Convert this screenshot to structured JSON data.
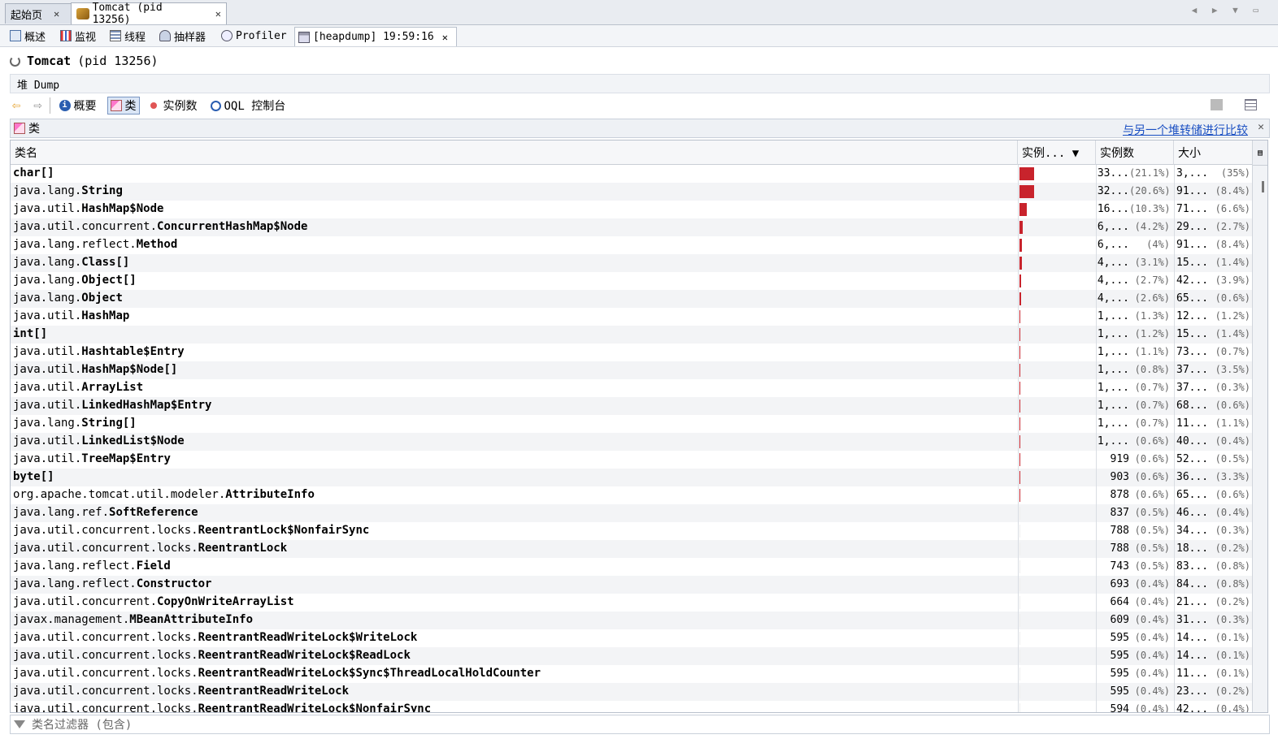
{
  "tabs": [
    {
      "label": "起始页",
      "close": "✕"
    },
    {
      "label": "Tomcat (pid 13256)",
      "close": "✕"
    }
  ],
  "subtabs": [
    {
      "label": "概述",
      "icon": "overview-icon"
    },
    {
      "label": "监视",
      "icon": "monitor-icon"
    },
    {
      "label": "线程",
      "icon": "threads-icon"
    },
    {
      "label": "抽样器",
      "icon": "sampler-icon"
    },
    {
      "label": "Profiler",
      "icon": "profiler-icon"
    },
    {
      "label": "[heapdump] 19:59:16",
      "icon": "heapdump-icon",
      "close": "✕"
    }
  ],
  "app": {
    "name": "Tomcat",
    "pid": "(pid 13256)"
  },
  "heap_label": "堆 Dump",
  "toolbar": {
    "summary": "概要",
    "classes": "类",
    "instances": "实例数",
    "oql": "OQL 控制台"
  },
  "classes_panel": {
    "title": "类",
    "compare_link": "与另一个堆转储进行比较",
    "close": "✕"
  },
  "columns": {
    "name": "类名",
    "instances_bar": "实例... ▼",
    "instances": "实例数",
    "size": "大小"
  },
  "rows": [
    {
      "pkg": "",
      "cls": "char[]",
      "bar": 21.1,
      "count": "33...",
      "count_pct": "(21.1%)",
      "size": "3,...",
      "size_pct": "(35%)"
    },
    {
      "pkg": "java.lang.",
      "cls": "String",
      "bar": 20.6,
      "count": "32...",
      "count_pct": "(20.6%)",
      "size": "91...",
      "size_pct": "(8.4%)"
    },
    {
      "pkg": "java.util.",
      "cls": "HashMap$Node",
      "bar": 10.3,
      "count": "16...",
      "count_pct": "(10.3%)",
      "size": "71...",
      "size_pct": "(6.6%)"
    },
    {
      "pkg": "java.util.concurrent.",
      "cls": "ConcurrentHashMap$Node",
      "bar": 4.2,
      "count": "6,...",
      "count_pct": "(4.2%)",
      "size": "29...",
      "size_pct": "(2.7%)"
    },
    {
      "pkg": "java.lang.reflect.",
      "cls": "Method",
      "bar": 4,
      "count": "6,...",
      "count_pct": "(4%)",
      "size": "91...",
      "size_pct": "(8.4%)"
    },
    {
      "pkg": "java.lang.",
      "cls": "Class[]",
      "bar": 3.1,
      "count": "4,...",
      "count_pct": "(3.1%)",
      "size": "15...",
      "size_pct": "(1.4%)"
    },
    {
      "pkg": "java.lang.",
      "cls": "Object[]",
      "bar": 2.7,
      "count": "4,...",
      "count_pct": "(2.7%)",
      "size": "42...",
      "size_pct": "(3.9%)"
    },
    {
      "pkg": "java.lang.",
      "cls": "Object",
      "bar": 2.6,
      "count": "4,...",
      "count_pct": "(2.6%)",
      "size": "65...",
      "size_pct": "(0.6%)"
    },
    {
      "pkg": "java.util.",
      "cls": "HashMap",
      "bar": 1.3,
      "count": "1,...",
      "count_pct": "(1.3%)",
      "size": "12...",
      "size_pct": "(1.2%)"
    },
    {
      "pkg": "",
      "cls": "int[]",
      "bar": 1.2,
      "count": "1,...",
      "count_pct": "(1.2%)",
      "size": "15...",
      "size_pct": "(1.4%)"
    },
    {
      "pkg": "java.util.",
      "cls": "Hashtable$Entry",
      "bar": 1.1,
      "count": "1,...",
      "count_pct": "(1.1%)",
      "size": "73...",
      "size_pct": "(0.7%)"
    },
    {
      "pkg": "java.util.",
      "cls": "HashMap$Node[]",
      "bar": 0.8,
      "count": "1,...",
      "count_pct": "(0.8%)",
      "size": "37...",
      "size_pct": "(3.5%)"
    },
    {
      "pkg": "java.util.",
      "cls": "ArrayList",
      "bar": 0.7,
      "count": "1,...",
      "count_pct": "(0.7%)",
      "size": "37...",
      "size_pct": "(0.3%)"
    },
    {
      "pkg": "java.util.",
      "cls": "LinkedHashMap$Entry",
      "bar": 0.7,
      "count": "1,...",
      "count_pct": "(0.7%)",
      "size": "68...",
      "size_pct": "(0.6%)"
    },
    {
      "pkg": "java.lang.",
      "cls": "String[]",
      "bar": 0.7,
      "count": "1,...",
      "count_pct": "(0.7%)",
      "size": "11...",
      "size_pct": "(1.1%)"
    },
    {
      "pkg": "java.util.",
      "cls": "LinkedList$Node",
      "bar": 0.6,
      "count": "1,...",
      "count_pct": "(0.6%)",
      "size": "40...",
      "size_pct": "(0.4%)"
    },
    {
      "pkg": "java.util.",
      "cls": "TreeMap$Entry",
      "bar": 0.6,
      "count": "919",
      "count_pct": "(0.6%)",
      "size": "52...",
      "size_pct": "(0.5%)"
    },
    {
      "pkg": "",
      "cls": "byte[]",
      "bar": 0.6,
      "count": "903",
      "count_pct": "(0.6%)",
      "size": "36...",
      "size_pct": "(3.3%)"
    },
    {
      "pkg": "org.apache.tomcat.util.modeler.",
      "cls": "AttributeInfo",
      "bar": 0.6,
      "count": "878",
      "count_pct": "(0.6%)",
      "size": "65...",
      "size_pct": "(0.6%)"
    },
    {
      "pkg": "java.lang.ref.",
      "cls": "SoftReference",
      "bar": 0.5,
      "count": "837",
      "count_pct": "(0.5%)",
      "size": "46...",
      "size_pct": "(0.4%)"
    },
    {
      "pkg": "java.util.concurrent.locks.",
      "cls": "ReentrantLock$NonfairSync",
      "bar": 0.5,
      "count": "788",
      "count_pct": "(0.5%)",
      "size": "34...",
      "size_pct": "(0.3%)"
    },
    {
      "pkg": "java.util.concurrent.locks.",
      "cls": "ReentrantLock",
      "bar": 0.5,
      "count": "788",
      "count_pct": "(0.5%)",
      "size": "18...",
      "size_pct": "(0.2%)"
    },
    {
      "pkg": "java.lang.reflect.",
      "cls": "Field",
      "bar": 0.5,
      "count": "743",
      "count_pct": "(0.5%)",
      "size": "83...",
      "size_pct": "(0.8%)"
    },
    {
      "pkg": "java.lang.reflect.",
      "cls": "Constructor",
      "bar": 0.4,
      "count": "693",
      "count_pct": "(0.4%)",
      "size": "84...",
      "size_pct": "(0.8%)"
    },
    {
      "pkg": "java.util.concurrent.",
      "cls": "CopyOnWriteArrayList",
      "bar": 0.4,
      "count": "664",
      "count_pct": "(0.4%)",
      "size": "21...",
      "size_pct": "(0.2%)"
    },
    {
      "pkg": "javax.management.",
      "cls": "MBeanAttributeInfo",
      "bar": 0.4,
      "count": "609",
      "count_pct": "(0.4%)",
      "size": "31...",
      "size_pct": "(0.3%)"
    },
    {
      "pkg": "java.util.concurrent.locks.",
      "cls": "ReentrantReadWriteLock$WriteLock",
      "bar": 0.4,
      "count": "595",
      "count_pct": "(0.4%)",
      "size": "14...",
      "size_pct": "(0.1%)"
    },
    {
      "pkg": "java.util.concurrent.locks.",
      "cls": "ReentrantReadWriteLock$ReadLock",
      "bar": 0.4,
      "count": "595",
      "count_pct": "(0.4%)",
      "size": "14...",
      "size_pct": "(0.1%)"
    },
    {
      "pkg": "java.util.concurrent.locks.",
      "cls": "ReentrantReadWriteLock$Sync$ThreadLocalHoldCounter",
      "bar": 0.4,
      "count": "595",
      "count_pct": "(0.4%)",
      "size": "11...",
      "size_pct": "(0.1%)"
    },
    {
      "pkg": "java.util.concurrent.locks.",
      "cls": "ReentrantReadWriteLock",
      "bar": 0.4,
      "count": "595",
      "count_pct": "(0.4%)",
      "size": "23...",
      "size_pct": "(0.2%)"
    },
    {
      "pkg": "java.util.concurrent.locks.",
      "cls": "ReentrantReadWriteLock$NonfairSync",
      "bar": 0.4,
      "count": "594",
      "count_pct": "(0.4%)",
      "size": "42...",
      "size_pct": "(0.4%)"
    }
  ],
  "filter": {
    "placeholder": "类名过滤器 (包含)"
  },
  "colors": {
    "bar": "#c8232c",
    "link": "#1a4fc2"
  }
}
